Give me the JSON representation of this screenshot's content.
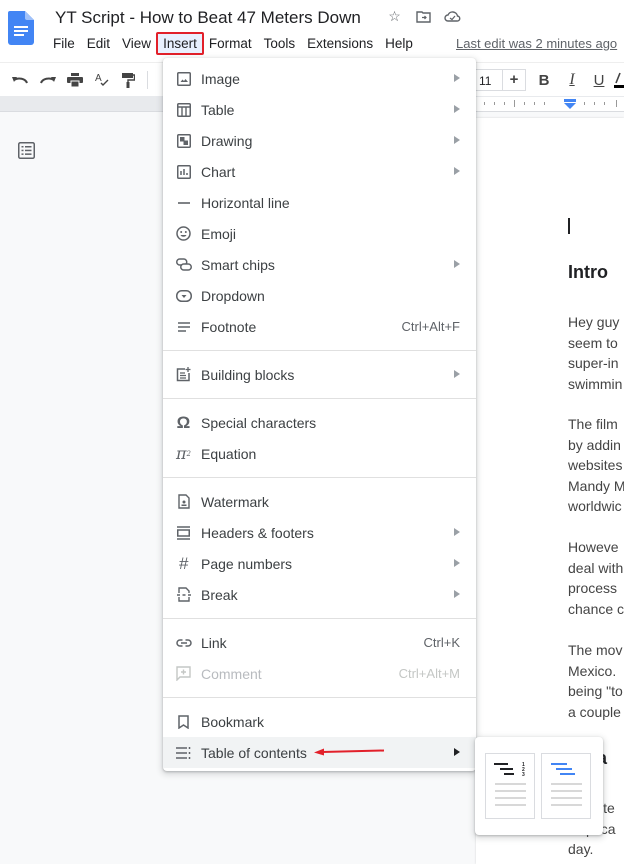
{
  "header": {
    "doc_title": "YT Script - How to Beat 47 Meters Down",
    "icons": [
      "star-icon",
      "move-to-folder-icon",
      "cloud-saved-icon"
    ],
    "last_edit": "Last edit was 2 minutes ago"
  },
  "menubar": {
    "items": [
      "File",
      "Edit",
      "View",
      "Insert",
      "Format",
      "Tools",
      "Extensions",
      "Help"
    ],
    "active": "Insert"
  },
  "toolbar": {
    "buttons": [
      "undo-icon",
      "redo-icon",
      "print-icon",
      "spellcheck-icon",
      "paint-format-icon"
    ],
    "font_size": "11",
    "plus_label": "+",
    "bold_label": "B",
    "italic_label": "I",
    "underline_label": "U"
  },
  "insert_menu": {
    "groups": [
      [
        {
          "label": "Image",
          "icon": "image-icon",
          "submenu": true
        },
        {
          "label": "Table",
          "icon": "table-icon",
          "submenu": true
        },
        {
          "label": "Drawing",
          "icon": "drawing-icon",
          "submenu": true
        },
        {
          "label": "Chart",
          "icon": "chart-icon",
          "submenu": true
        },
        {
          "label": "Horizontal line",
          "icon": "horizontal-line-icon"
        },
        {
          "label": "Emoji",
          "icon": "emoji-icon"
        },
        {
          "label": "Smart chips",
          "icon": "smart-chips-icon",
          "submenu": true
        },
        {
          "label": "Dropdown",
          "icon": "dropdown-icon"
        },
        {
          "label": "Footnote",
          "icon": "footnote-icon",
          "shortcut": "Ctrl+Alt+F"
        }
      ],
      [
        {
          "label": "Building blocks",
          "icon": "building-blocks-icon",
          "submenu": true
        }
      ],
      [
        {
          "label": "Special characters",
          "icon": "omega-icon"
        },
        {
          "label": "Equation",
          "icon": "pi-icon"
        }
      ],
      [
        {
          "label": "Watermark",
          "icon": "watermark-icon"
        },
        {
          "label": "Headers & footers",
          "icon": "headers-footers-icon",
          "submenu": true
        },
        {
          "label": "Page numbers",
          "icon": "hash-icon",
          "submenu": true
        },
        {
          "label": "Break",
          "icon": "break-icon",
          "submenu": true
        }
      ],
      [
        {
          "label": "Link",
          "icon": "link-icon",
          "shortcut": "Ctrl+K"
        },
        {
          "label": "Comment",
          "icon": "comment-icon",
          "shortcut": "Ctrl+Alt+M",
          "disabled": true
        }
      ],
      [
        {
          "label": "Bookmark",
          "icon": "bookmark-icon"
        },
        {
          "label": "Table of contents",
          "icon": "toc-icon",
          "submenu": true,
          "highlighted": true
        }
      ]
    ]
  },
  "toc_submenu": {
    "options": [
      "toc-with-page-numbers",
      "toc-with-blue-links"
    ]
  },
  "document": {
    "heading1": "Intro",
    "paragraphs": [
      [
        "Hey guy",
        "seem to",
        "super-in",
        "swimmin"
      ],
      [
        "The film",
        "by addin",
        "websites",
        "Mandy M",
        "worldwic"
      ],
      [
        "Howeve",
        "deal with",
        "process",
        "chance c"
      ],
      [
        "The mov",
        "Mexico.",
        "being \"to",
        "a couple"
      ]
    ],
    "heading2": "ha",
    "tail_lines": [
      "siste",
      "ptica",
      "day."
    ]
  },
  "colors": {
    "accent_blue": "#4285f4",
    "highlight_red": "#e2202a",
    "menu_hover": "#f1f3f4"
  }
}
